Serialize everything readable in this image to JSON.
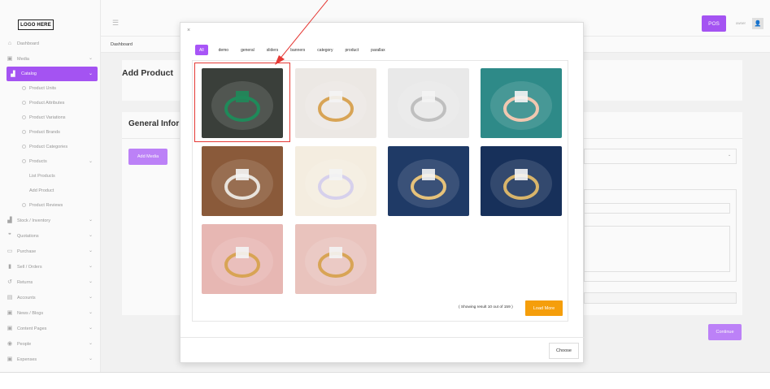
{
  "logo": "LOGO HERE",
  "topbar": {
    "pos_label": "POS",
    "owner_label": "owner",
    "menu_icon": "hamburger-icon",
    "avatar_icon": "user-icon"
  },
  "breadcrumb": "Dashboard",
  "page": {
    "title": "Add Product",
    "section_title": "General Infor",
    "add_media_label": "Add Media",
    "continue_label": "Continue"
  },
  "sidebar": {
    "items": [
      {
        "label": "Dashboard",
        "icon": "home-icon",
        "type": "top"
      },
      {
        "label": "Media",
        "icon": "image-icon",
        "type": "top",
        "chevron": true
      },
      {
        "label": "Catalog",
        "icon": "catalog-icon",
        "type": "active",
        "chevron": true
      },
      {
        "label": "Product Units",
        "type": "sub"
      },
      {
        "label": "Product Attributes",
        "type": "sub"
      },
      {
        "label": "Product Variations",
        "type": "sub"
      },
      {
        "label": "Product Brands",
        "type": "sub"
      },
      {
        "label": "Product Categories",
        "type": "sub"
      },
      {
        "label": "Products",
        "type": "sub",
        "chevron": true
      },
      {
        "label": "List Products",
        "type": "sub2"
      },
      {
        "label": "Add Product",
        "type": "sub2"
      },
      {
        "label": "Product Reviews",
        "type": "sub"
      },
      {
        "label": "Stock / Inventory",
        "icon": "stock-icon",
        "type": "top",
        "chevron": true
      },
      {
        "label": "Quotations",
        "icon": "quote-icon",
        "type": "top",
        "chevron": true
      },
      {
        "label": "Purchase",
        "icon": "card-icon",
        "type": "top",
        "chevron": true
      },
      {
        "label": "Sell / Orders",
        "icon": "clipboard-icon",
        "type": "top",
        "chevron": true
      },
      {
        "label": "Returns",
        "icon": "return-icon",
        "type": "top",
        "chevron": true
      },
      {
        "label": "Accounts",
        "icon": "file-icon",
        "type": "top",
        "chevron": true
      },
      {
        "label": "News / Blogs",
        "icon": "news-icon",
        "type": "top",
        "chevron": true
      },
      {
        "label": "Content Pages",
        "icon": "page-icon",
        "type": "top",
        "chevron": true
      },
      {
        "label": "People",
        "icon": "people-icon",
        "type": "top",
        "chevron": true
      },
      {
        "label": "Expenses",
        "icon": "expense-icon",
        "type": "top",
        "chevron": true
      }
    ]
  },
  "modal": {
    "close_label": "×",
    "tabs": [
      "All",
      "demo",
      "general",
      "sliders",
      "banners",
      "category",
      "product",
      "parallax"
    ],
    "active_tab": "All",
    "showing_text": "( Showing result 10 out of 159 )",
    "load_more_label": "Load More",
    "choose_label": "Choose",
    "images": [
      {
        "name": "emerald-ring-image",
        "bg": "#3a3f3a",
        "accent": "#1f8a5a"
      },
      {
        "name": "diamond-gold-ring-image",
        "bg": "#ece8e4",
        "accent": "#d8a455"
      },
      {
        "name": "flower-diamond-ring-image",
        "bg": "#e9e9e9",
        "accent": "#bfbfbf"
      },
      {
        "name": "hand-ring-image",
        "bg": "#2e8a88",
        "accent": "#f1c7b0"
      },
      {
        "name": "wood-band-ring-image",
        "bg": "#8a5a3a",
        "accent": "#e8e3dc"
      },
      {
        "name": "rose-ring-image",
        "bg": "#f4ede0",
        "accent": "#d6d0ec"
      },
      {
        "name": "blue-box-ring-image",
        "bg": "#1f3a66",
        "accent": "#e6c27a"
      },
      {
        "name": "navy-box-gold-ring-image",
        "bg": "#17305a",
        "accent": "#d9b56a"
      },
      {
        "name": "pink-gold-ring-image",
        "bg": "#e7b7b3",
        "accent": "#d8a455"
      },
      {
        "name": "pink-flower-ring-image",
        "bg": "#e9c3bd",
        "accent": "#d8a455"
      }
    ]
  },
  "colors": {
    "accent": "#a855f7",
    "load_more": "#f59e0b",
    "highlight": "#e53935"
  }
}
